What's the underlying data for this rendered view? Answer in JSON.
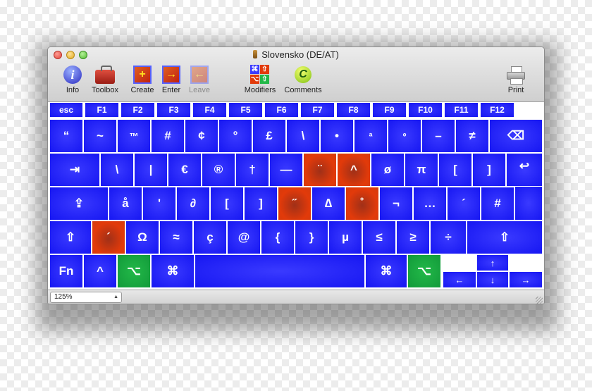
{
  "window": {
    "title": "Slovensko (DE/AT)"
  },
  "toolbar": {
    "info": {
      "label": "Info",
      "icon": "info-icon"
    },
    "toolbox": {
      "label": "Toolbox",
      "icon": "toolbox-icon"
    },
    "create": {
      "label": "Create",
      "icon": "create-key-icon"
    },
    "enter": {
      "label": "Enter",
      "icon": "enter-key-icon"
    },
    "leave": {
      "label": "Leave",
      "icon": "leave-key-icon"
    },
    "modifiers": {
      "label": "Modifiers",
      "icon": "modifiers-icon"
    },
    "comments": {
      "label": "Comments",
      "icon": "comments-icon",
      "glyph": "C"
    },
    "print": {
      "label": "Print",
      "icon": "printer-icon"
    }
  },
  "keyboard": {
    "colors": {
      "normal": "#1616f2",
      "dead_key": "#e23a0a",
      "modifier_active": "#129a3a"
    },
    "function_row": [
      "esc",
      "F1",
      "F2",
      "F3",
      "F4",
      "F5",
      "F6",
      "F7",
      "F8",
      "F9",
      "F10",
      "F11",
      "F12"
    ],
    "row1": [
      "“",
      "~",
      "™",
      "#",
      "¢",
      "°",
      "£",
      "\\",
      "•",
      "ª",
      "º",
      "–",
      "≠",
      "⌫"
    ],
    "row2": [
      "⇥",
      "\\",
      "|",
      "€",
      "®",
      "†",
      "—",
      "¨",
      "^",
      "ø",
      "π",
      "[",
      "]",
      "↩"
    ],
    "row3": [
      "⇪",
      "å",
      "'",
      "∂",
      "[",
      "]",
      "˝",
      "∆",
      "˚",
      "¬",
      "…",
      "´",
      "#"
    ],
    "row4": [
      "⇧",
      "´",
      "Ω",
      "≈",
      "ç",
      "@",
      "{",
      "}",
      "µ",
      "≤",
      "≥",
      "÷",
      "⇧"
    ],
    "row5": [
      "Fn",
      "^",
      "⌥",
      "⌘",
      "",
      "⌘",
      "⌥"
    ],
    "arrows": {
      "up": "↑",
      "left": "←",
      "down": "↓",
      "right": "→"
    }
  },
  "statusbar": {
    "zoom": "125%"
  }
}
